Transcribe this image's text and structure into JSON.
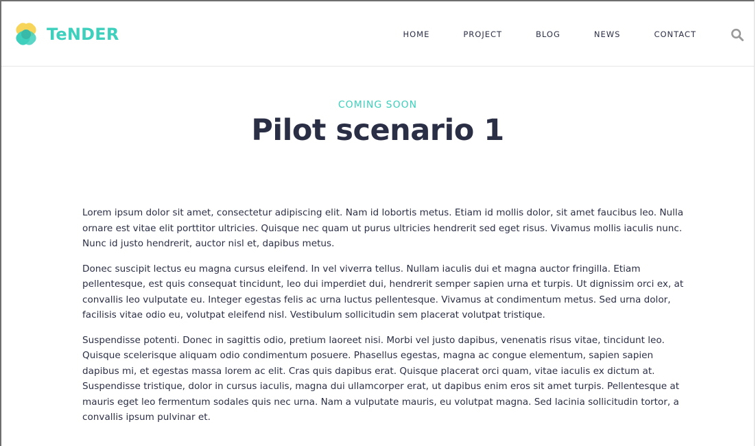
{
  "brand": {
    "name": "TeNDER",
    "accent_color": "#3fd0bd",
    "logo_colors": [
      "#f7d55a",
      "#3fd0bd"
    ]
  },
  "nav": {
    "items": [
      "HOME",
      "PROJECT",
      "BLOG",
      "NEWS",
      "CONTACT"
    ],
    "search_icon": "search-icon"
  },
  "hero": {
    "kicker": "COMING SOON",
    "title": "Pilot scenario 1"
  },
  "content": {
    "paragraphs": [
      "Lorem ipsum dolor sit amet, consectetur adipiscing elit. Nam id lobortis metus. Etiam id mollis dolor, sit amet faucibus leo. Nulla ornare est vitae elit porttitor ultricies. Quisque nec quam ut purus ultricies hendrerit sed eget risus. Vivamus mollis iaculis nunc. Nunc id justo hendrerit, auctor nisl et, dapibus metus.",
      "Donec suscipit lectus eu magna cursus eleifend. In vel viverra tellus. Nullam iaculis dui et magna auctor fringilla. Etiam pellentesque, est quis consequat tincidunt, leo dui imperdiet dui, hendrerit semper sapien urna et turpis. Ut dignissim orci ex, at convallis leo vulputate eu. Integer egestas felis ac urna luctus pellentesque. Vivamus at condimentum metus. Sed urna dolor, facilisis vitae odio eu, volutpat eleifend nisl. Vestibulum sollicitudin sem placerat volutpat tristique.",
      "Suspendisse potenti. Donec in sagittis odio, pretium laoreet nisi. Morbi vel justo dapibus, venenatis risus vitae, tincidunt leo. Quisque scelerisque aliquam odio condimentum posuere. Phasellus egestas, magna ac congue elementum, sapien sapien dapibus mi, et egestas massa lorem ac elit. Cras quis dapibus erat. Quisque placerat orci quam, vitae iaculis ex dictum at. Suspendisse tristique, dolor in cursus iaculis, magna dui ullamcorper erat, ut dapibus enim eros sit amet turpis. Pellentesque at mauris eget leo fermentum sodales quis nec urna. Nam a vulputate mauris, eu volutpat magna. Sed lacinia sollicitudin tortor, a convallis ipsum pulvinar et."
    ]
  }
}
